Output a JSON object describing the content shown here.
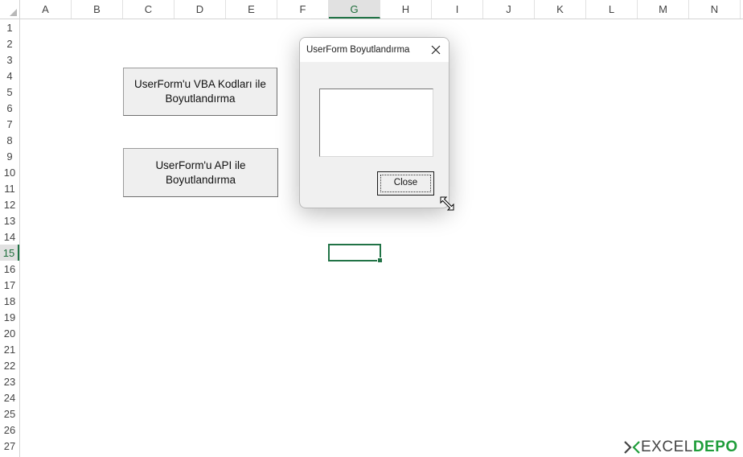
{
  "columns": [
    "A",
    "B",
    "C",
    "D",
    "E",
    "F",
    "G",
    "H",
    "I",
    "J",
    "K",
    "L",
    "M",
    "N"
  ],
  "rows": [
    "1",
    "2",
    "3",
    "4",
    "5",
    "6",
    "7",
    "8",
    "9",
    "10",
    "11",
    "12",
    "13",
    "14",
    "15",
    "16",
    "17",
    "18",
    "19",
    "20",
    "21",
    "22",
    "23",
    "24",
    "25",
    "26",
    "27"
  ],
  "active_column": "G",
  "active_row": "15",
  "sheet_buttons": {
    "vba_line1": "UserForm'u VBA Kodları ile",
    "vba_line2": "Boyutlandırma",
    "api_line1": "UserForm'u API ile",
    "api_line2": "Boyutlandırma"
  },
  "dialog": {
    "title": "UserForm Boyutlandırma",
    "close_button_label": "Close",
    "textbox_value": ""
  },
  "watermark": {
    "excel": "EXCEL",
    "depo": "DEPO"
  },
  "colors": {
    "excel_green": "#217346",
    "logo_green": "#1f9d3a"
  }
}
